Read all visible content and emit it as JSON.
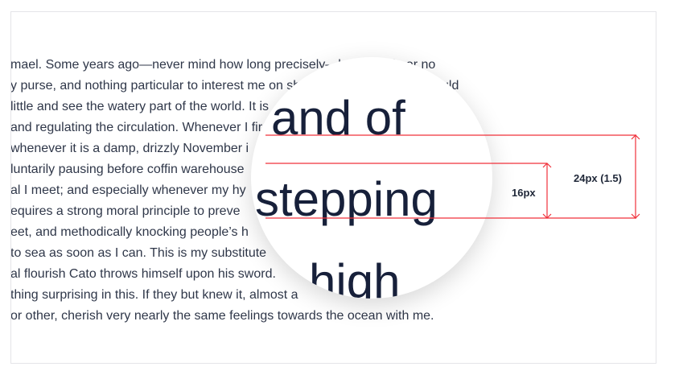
{
  "paragraph_lines": [
    "mael. Some years ago—never mind how long precisely—having little or no",
    "y purse, and nothing particular to interest me on sh",
    " little and see the watery part of the world. It is",
    "and regulating the circulation. Whenever I fir",
    "whenever it is a damp, drizzly November i",
    "luntarily pausing before coffin warehouse",
    "al I meet; and especially whenever my hy",
    "equires a strong moral principle to preve",
    "eet, and methodically knocking people’s h",
    "to sea as soon as I can. This is my substitute",
    "al flourish Cato throws himself upon his sword.",
    "thing surprising in this. If they but knew it, almost a",
    "or other, cherish very nearly the same feelings towards the ocean with me."
  ],
  "line2_tail": "uld",
  "magnifier": {
    "words": [
      "and of",
      "stepping",
      "high"
    ]
  },
  "annotations": {
    "font_size_label": "16px",
    "line_height_label": "24px (1.5)"
  },
  "colors": {
    "guide": "#f0303a",
    "text": "#2f3749"
  }
}
